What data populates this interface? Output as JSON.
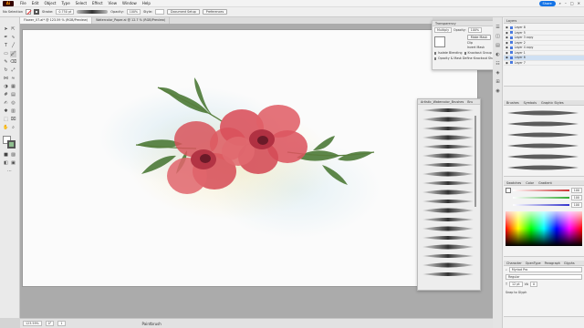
{
  "menu": {
    "logo": "Ai",
    "items": [
      "File",
      "Edit",
      "Object",
      "Type",
      "Select",
      "Effect",
      "View",
      "Window",
      "Help"
    ],
    "share": "Share"
  },
  "control": {
    "selection": "No Selection",
    "stroke_label": "Stroke:",
    "stroke_weight": "0.750 pt",
    "opacity_label": "Opacity:",
    "opacity_value": "100%",
    "style_label": "Style:",
    "doc_setup": "Document Setup",
    "preferences": "Preferences"
  },
  "tabs": [
    {
      "label": "Flower_07.ai* @ 123.59 % (RGB/Preview)",
      "active": true
    },
    {
      "label": "Watercolor_Paper.ai @ 12.7 % (RGB/Preview)",
      "active": false
    }
  ],
  "transparency": {
    "title": "Transparency",
    "blend": "Multiply",
    "opacity_label": "Opacity:",
    "opacity_value": "100%",
    "make_mask": "Make Mask",
    "clip": "Clip",
    "invert_mask": "Invert Mask",
    "isolate": "Isolate Blending",
    "knockout": "Knockout Group",
    "opacity_mask": "Opacity & Mask Define Knockout Shape"
  },
  "brush_library": {
    "title": "Artistic_Watercolor_Brushes",
    "tab2": "Bru"
  },
  "layers": {
    "title": "Layers",
    "items": [
      {
        "name": "Layer 8",
        "selected": false
      },
      {
        "name": "Layer 5",
        "selected": false
      },
      {
        "name": "Layer 3 copy",
        "selected": false
      },
      {
        "name": "Layer 2",
        "selected": false
      },
      {
        "name": "Layer 4 copy",
        "selected": false
      },
      {
        "name": "Layer 1",
        "selected": false
      },
      {
        "name": "Layer 6",
        "selected": true
      },
      {
        "name": "Layer 7",
        "selected": false
      }
    ]
  },
  "brushes_panel": {
    "tabs": [
      "Brushes",
      "Symbols",
      "Graphic Styles"
    ]
  },
  "color_panel": {
    "tabs": [
      "Swatches",
      "Color",
      "Gradient"
    ],
    "values": [
      "100",
      "100",
      "100"
    ]
  },
  "character": {
    "tabs": [
      "Character",
      "OpenType",
      "Paragraph",
      "Glyphs",
      "Paragraph"
    ],
    "font": "Myriad Pro",
    "style": "Regular",
    "size": "12 pt",
    "tracking": "0",
    "snap": "Snap to Glyph"
  },
  "status": {
    "zoom": "123.59%",
    "rotation": "0°",
    "page": "1",
    "tool": "Paintbrush"
  },
  "colors": {
    "petal": "#d95058",
    "petal_dark": "#8a2434",
    "leaf": "#4d7a38",
    "accent": "#1473e6"
  }
}
